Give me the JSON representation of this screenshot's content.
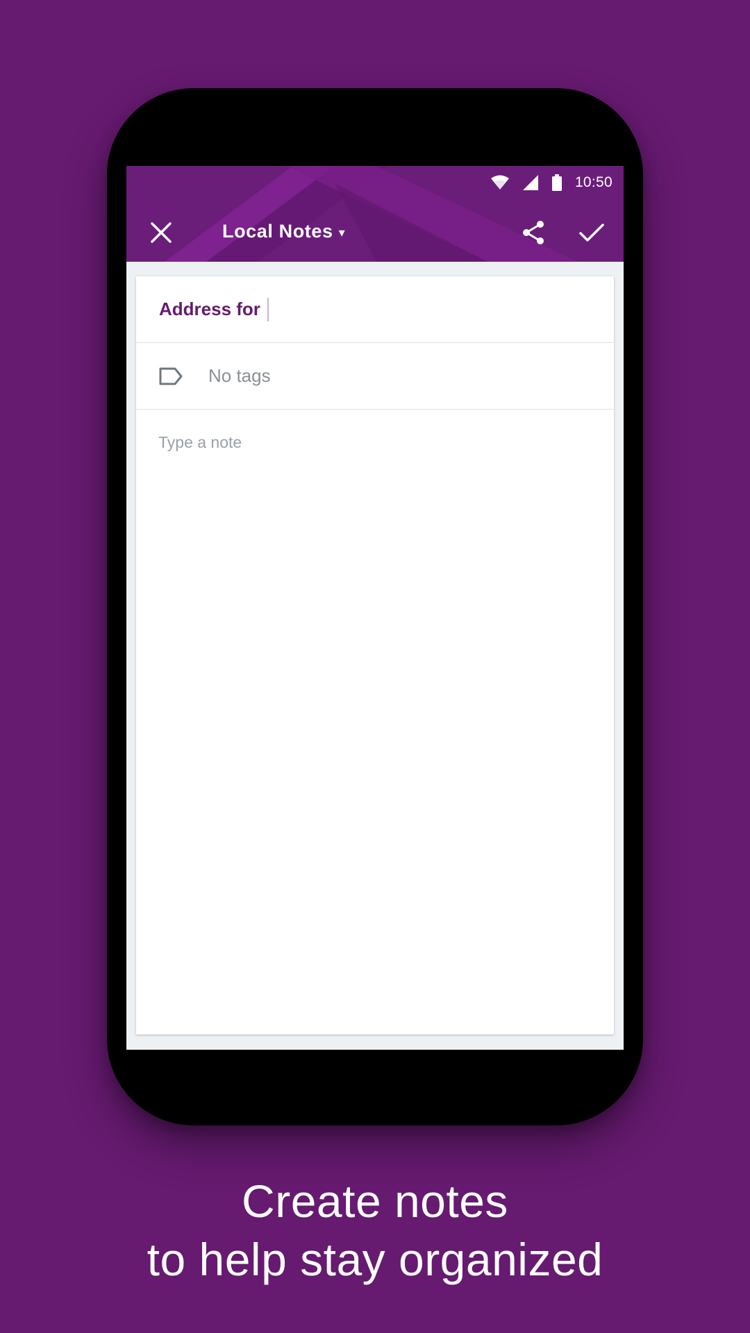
{
  "status_bar": {
    "time": "10:50",
    "icons": [
      "wifi-icon",
      "signal-icon",
      "battery-icon"
    ]
  },
  "toolbar": {
    "title": "Local Notes",
    "caret": "▾",
    "icons": [
      "close-icon",
      "share-icon",
      "check-icon"
    ]
  },
  "note": {
    "title": "Address for",
    "tags_label": "No tags",
    "body_placeholder": "Type a note"
  },
  "caption": {
    "line1": "Create notes",
    "line2": "to help stay organized"
  },
  "colors": {
    "background": "#661a70",
    "appbar": "#6b1d7a",
    "title_text": "#661a70"
  }
}
